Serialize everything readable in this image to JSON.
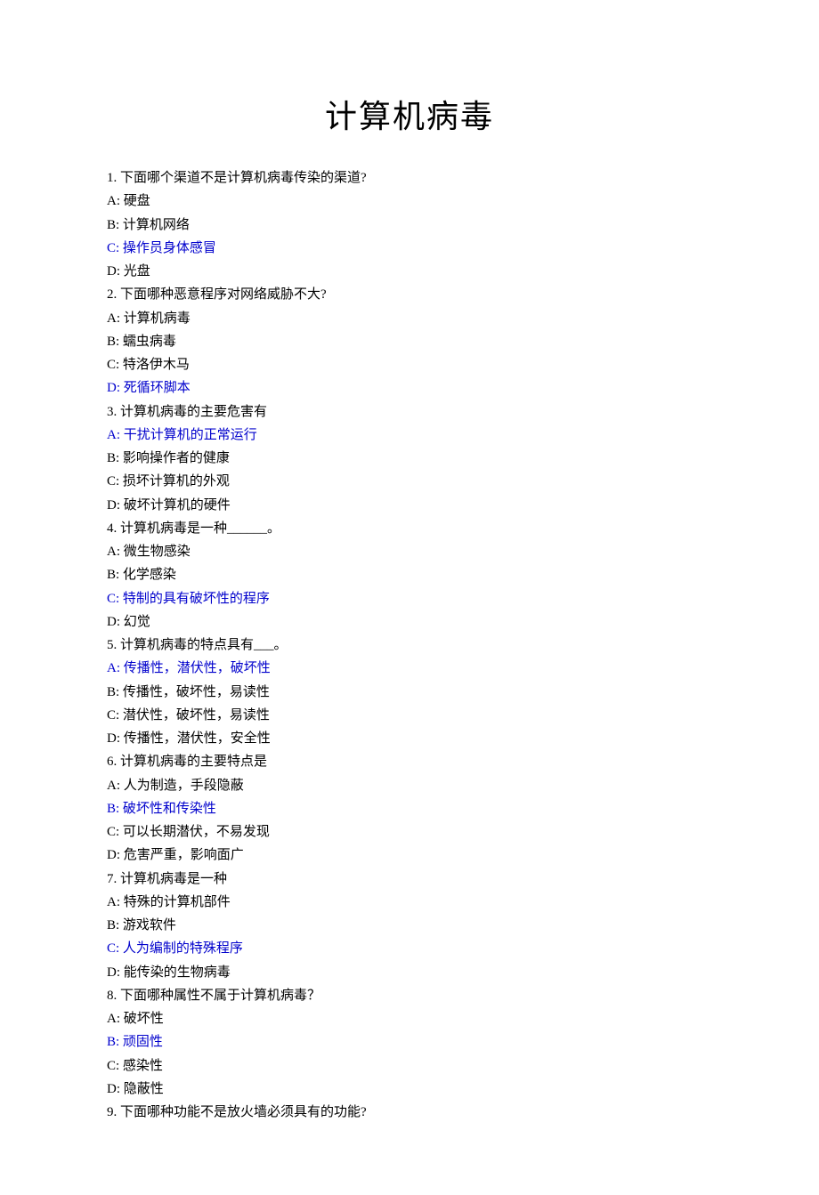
{
  "title": "计算机病毒",
  "questions": [
    {
      "number": "1.",
      "text": "下面哪个渠道不是计算机病毒传染的渠道?",
      "options": [
        {
          "label": "A:",
          "text": "硬盘",
          "highlighted": false
        },
        {
          "label": "B:",
          "text": "计算机网络",
          "highlighted": false
        },
        {
          "label": "C:",
          "text": "操作员身体感冒",
          "highlighted": true
        },
        {
          "label": "D:",
          "text": "光盘",
          "highlighted": false
        }
      ]
    },
    {
      "number": "2.",
      "text": "下面哪种恶意程序对网络威胁不大?",
      "options": [
        {
          "label": "A:",
          "text": "计算机病毒",
          "highlighted": false
        },
        {
          "label": "B:",
          "text": "蠕虫病毒",
          "highlighted": false
        },
        {
          "label": "C:",
          "text": "特洛伊木马",
          "highlighted": false
        },
        {
          "label": "D:",
          "text": "死循环脚本",
          "highlighted": true
        }
      ]
    },
    {
      "number": "3.",
      "text": " 计算机病毒的主要危害有",
      "options": [
        {
          "label": "A:",
          "text": "干扰计算机的正常运行",
          "highlighted": true
        },
        {
          "label": "B:",
          "text": "影响操作者的健康",
          "highlighted": false
        },
        {
          "label": "C:",
          "text": "损坏计算机的外观",
          "highlighted": false
        },
        {
          "label": "D:",
          "text": "破坏计算机的硬件",
          "highlighted": false
        }
      ]
    },
    {
      "number": "4.",
      "text": "计算机病毒是一种______。",
      "options": [
        {
          "label": "A:",
          "text": "微生物感染",
          "highlighted": false
        },
        {
          "label": "B:",
          "text": "化学感染",
          "highlighted": false
        },
        {
          "label": "C:",
          "text": "特制的具有破坏性的程序",
          "highlighted": true
        },
        {
          "label": "D:",
          "text": "幻觉",
          "highlighted": false
        }
      ]
    },
    {
      "number": "5.",
      "text": "计算机病毒的特点具有___。",
      "options": [
        {
          "label": "A:",
          "text": "传播性，潜伏性，破坏性",
          "highlighted": true
        },
        {
          "label": "B:",
          "text": "传播性，破坏性，易读性",
          "highlighted": false
        },
        {
          "label": "C:",
          "text": "潜伏性，破坏性，易读性",
          "highlighted": false
        },
        {
          "label": "D:",
          "text": "传播性，潜伏性，安全性",
          "highlighted": false
        }
      ]
    },
    {
      "number": "6.",
      "text": "计算机病毒的主要特点是",
      "options": [
        {
          "label": "A:",
          "text": "人为制造，手段隐蔽",
          "highlighted": false
        },
        {
          "label": "B:",
          "text": "破坏性和传染性",
          "highlighted": true
        },
        {
          "label": "C:",
          "text": "可以长期潜伏，不易发现",
          "highlighted": false
        },
        {
          "label": "D:",
          "text": "危害严重，影响面广",
          "highlighted": false
        }
      ]
    },
    {
      "number": "7.",
      "text": "计算机病毒是一种",
      "options": [
        {
          "label": "A:",
          "text": "特殊的计算机部件",
          "highlighted": false
        },
        {
          "label": "B:",
          "text": "游戏软件",
          "highlighted": false
        },
        {
          "label": "C:",
          "text": "人为编制的特殊程序",
          "highlighted": true
        },
        {
          "label": "D:",
          "text": "能传染的生物病毒",
          "highlighted": false
        }
      ]
    },
    {
      "number": "8.",
      "text": "下面哪种属性不属于计算机病毒？",
      "options": [
        {
          "label": "A:",
          "text": "破坏性",
          "highlighted": false
        },
        {
          "label": "B:",
          "text": "顽固性",
          "highlighted": true
        },
        {
          "label": "C:",
          "text": "感染性",
          "highlighted": false
        },
        {
          "label": "D:",
          "text": "隐蔽性",
          "highlighted": false
        }
      ]
    },
    {
      "number": "9.",
      "text": "下面哪种功能不是放火墙必须具有的功能?",
      "options": []
    }
  ]
}
